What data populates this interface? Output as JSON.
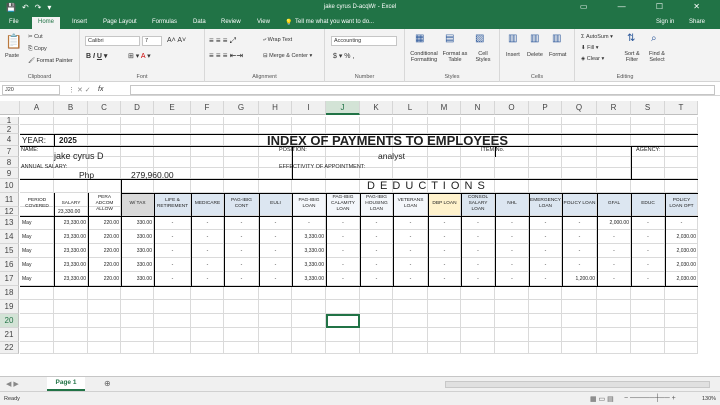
{
  "window": {
    "title": "jake cyrus D-acqWr - Excel",
    "sign_in": "Sign in",
    "share": "Share",
    "tell_me": "Tell me what you want to do..."
  },
  "tabs": [
    "File",
    "Home",
    "Insert",
    "Page Layout",
    "Formulas",
    "Data",
    "Review",
    "View"
  ],
  "ribbon": {
    "clipboard": {
      "label": "Clipboard",
      "paste": "Paste",
      "cut": "Cut",
      "copy": "Copy",
      "format_painter": "Format Painter"
    },
    "font": {
      "label": "Font",
      "name": "Calibri",
      "size": "7"
    },
    "alignment": {
      "label": "Alignment",
      "wrap": "Wrap Text",
      "merge": "Merge & Center"
    },
    "number": {
      "label": "Number",
      "format": "Accounting",
      "buttons": "$ ▾  %  ,"
    },
    "styles": {
      "label": "Styles",
      "cond": "Conditional Formatting",
      "fmt_table": "Format as Table",
      "cell_styles": "Cell Styles"
    },
    "cells": {
      "label": "Cells",
      "insert": "Insert",
      "delete": "Delete",
      "format": "Format"
    },
    "editing": {
      "label": "Editing",
      "autosum": "AutoSum",
      "fill": "Fill",
      "clear": "Clear",
      "sort": "Sort & Filter",
      "find": "Find & Select"
    }
  },
  "formula_bar": {
    "name_box": "J20",
    "fx": "fx",
    "value": ""
  },
  "columns": [
    "A",
    "B",
    "C",
    "D",
    "E",
    "F",
    "G",
    "H",
    "I",
    "J",
    "K",
    "L",
    "M",
    "N",
    "O",
    "P",
    "Q",
    "R",
    "S",
    "T"
  ],
  "rows": [
    "1",
    "2",
    "4",
    "7",
    "8",
    "9",
    "10",
    "11",
    "12",
    "13",
    "14",
    "15",
    "16",
    "17",
    "18",
    "19",
    "20",
    "21",
    "22"
  ],
  "sheet": {
    "title": "INDEX OF PAYMENTS TO EMPLOYEES",
    "year_label": "YEAR:",
    "year": "2025",
    "name_label": "NAME:",
    "name": "jake cyrus D",
    "position_label": "POSITION:",
    "position": "analyst",
    "item_label": "ITEM No.",
    "agency_label": "AGENCY:",
    "salary_label": "ANNUAL SALARY:",
    "currency": "Php",
    "annual_salary": "279,960.00",
    "appointment_label": "EFFECTIVITY OF APPOINTMENT:",
    "deductions": "D E D U C T I O N S",
    "headers": [
      "PERIOD COVERED",
      "SALARY",
      "PERA ADCOM ALLOW",
      "W/ TAX",
      "LIFE & RETIREMENT",
      "MEDICARE",
      "PAG-IBIG CONT",
      "EULI",
      "PAG-IBIG LOAN",
      "PAG-IBIG CALAMITY LOAN",
      "PAG-IBIG HOUSING LOAN",
      "VETERANS LOAN",
      "DBP LOAN",
      "CONSOL SALARY LOAN",
      "NHL",
      "EMERGENCY LOAN",
      "POLICY LOAN",
      "GFAL",
      "EDUC",
      "POLICY LOAN OPT"
    ],
    "base_salary": "23,330.00",
    "data_rows": [
      [
        "May",
        "23,330.00",
        "220.00",
        "330.00",
        "-",
        "-",
        "-",
        "-",
        "-",
        "-",
        "-",
        "-",
        "-",
        "-",
        "-",
        "-",
        "-",
        "2,000.00",
        "-",
        "-"
      ],
      [
        "May",
        "23,330.00",
        "220.00",
        "330.00",
        "-",
        "-",
        "-",
        "-",
        "3,330.00",
        "-",
        "-",
        "-",
        "-",
        "-",
        "-",
        "-",
        "-",
        "-",
        "-",
        "2,030.00"
      ],
      [
        "May",
        "23,330.00",
        "220.00",
        "330.00",
        "-",
        "-",
        "-",
        "-",
        "3,330.00",
        "-",
        "-",
        "-",
        "-",
        "-",
        "-",
        "-",
        "-",
        "-",
        "-",
        "2,030.00"
      ],
      [
        "May",
        "23,330.00",
        "220.00",
        "330.00",
        "-",
        "-",
        "-",
        "-",
        "3,330.00",
        "-",
        "-",
        "-",
        "-",
        "-",
        "-",
        "-",
        "-",
        "-",
        "-",
        "2,030.00"
      ],
      [
        "May",
        "23,330.00",
        "220.00",
        "330.00",
        "-",
        "-",
        "-",
        "-",
        "3,330.00",
        "-",
        "-",
        "-",
        "-",
        "-",
        "-",
        "-",
        "1,200.00",
        "-",
        "-",
        "2,030.00"
      ]
    ]
  },
  "sheet_tabs": [
    "Page 1"
  ],
  "status": {
    "ready": "Ready",
    "zoom": "130%"
  },
  "colors": {
    "excel_green": "#217346",
    "pale_blue": "#dce6f1",
    "pale_yellow": "#fff2cc"
  }
}
